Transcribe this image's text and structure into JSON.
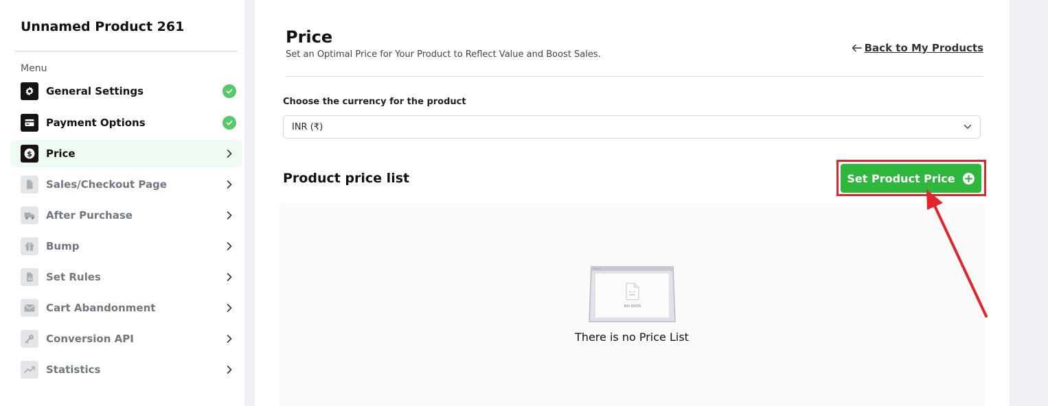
{
  "sidebar": {
    "product_title": "Unnamed Product 261",
    "menu_label": "Menu",
    "items": [
      {
        "label": "General Settings",
        "status": "complete"
      },
      {
        "label": "Payment Options",
        "status": "complete"
      },
      {
        "label": "Price",
        "status": "active"
      },
      {
        "label": "Sales/Checkout Page",
        "status": "disabled"
      },
      {
        "label": "After Purchase",
        "status": "disabled"
      },
      {
        "label": "Bump",
        "status": "disabled"
      },
      {
        "label": "Set Rules",
        "status": "disabled"
      },
      {
        "label": "Cart Abandonment",
        "status": "disabled"
      },
      {
        "label": "Conversion API",
        "status": "disabled"
      },
      {
        "label": "Statistics",
        "status": "disabled"
      }
    ]
  },
  "main": {
    "title": "Price",
    "subtitle": "Set an Optimal Price for Your Product to Reflect Value and Boost Sales.",
    "back_link": "Back to My Products",
    "currency_label": "Choose the currency for the product",
    "currency_value": "INR (₹)",
    "list_title": "Product price list",
    "set_price_button": "Set Product Price",
    "empty_text": "There is no Price List",
    "nodata_caption": "NO DATA"
  },
  "colors": {
    "accent_green": "#2fb63c",
    "check_green": "#54c96a",
    "annotation_red": "#e0262b",
    "active_bg": "#effbf1"
  }
}
